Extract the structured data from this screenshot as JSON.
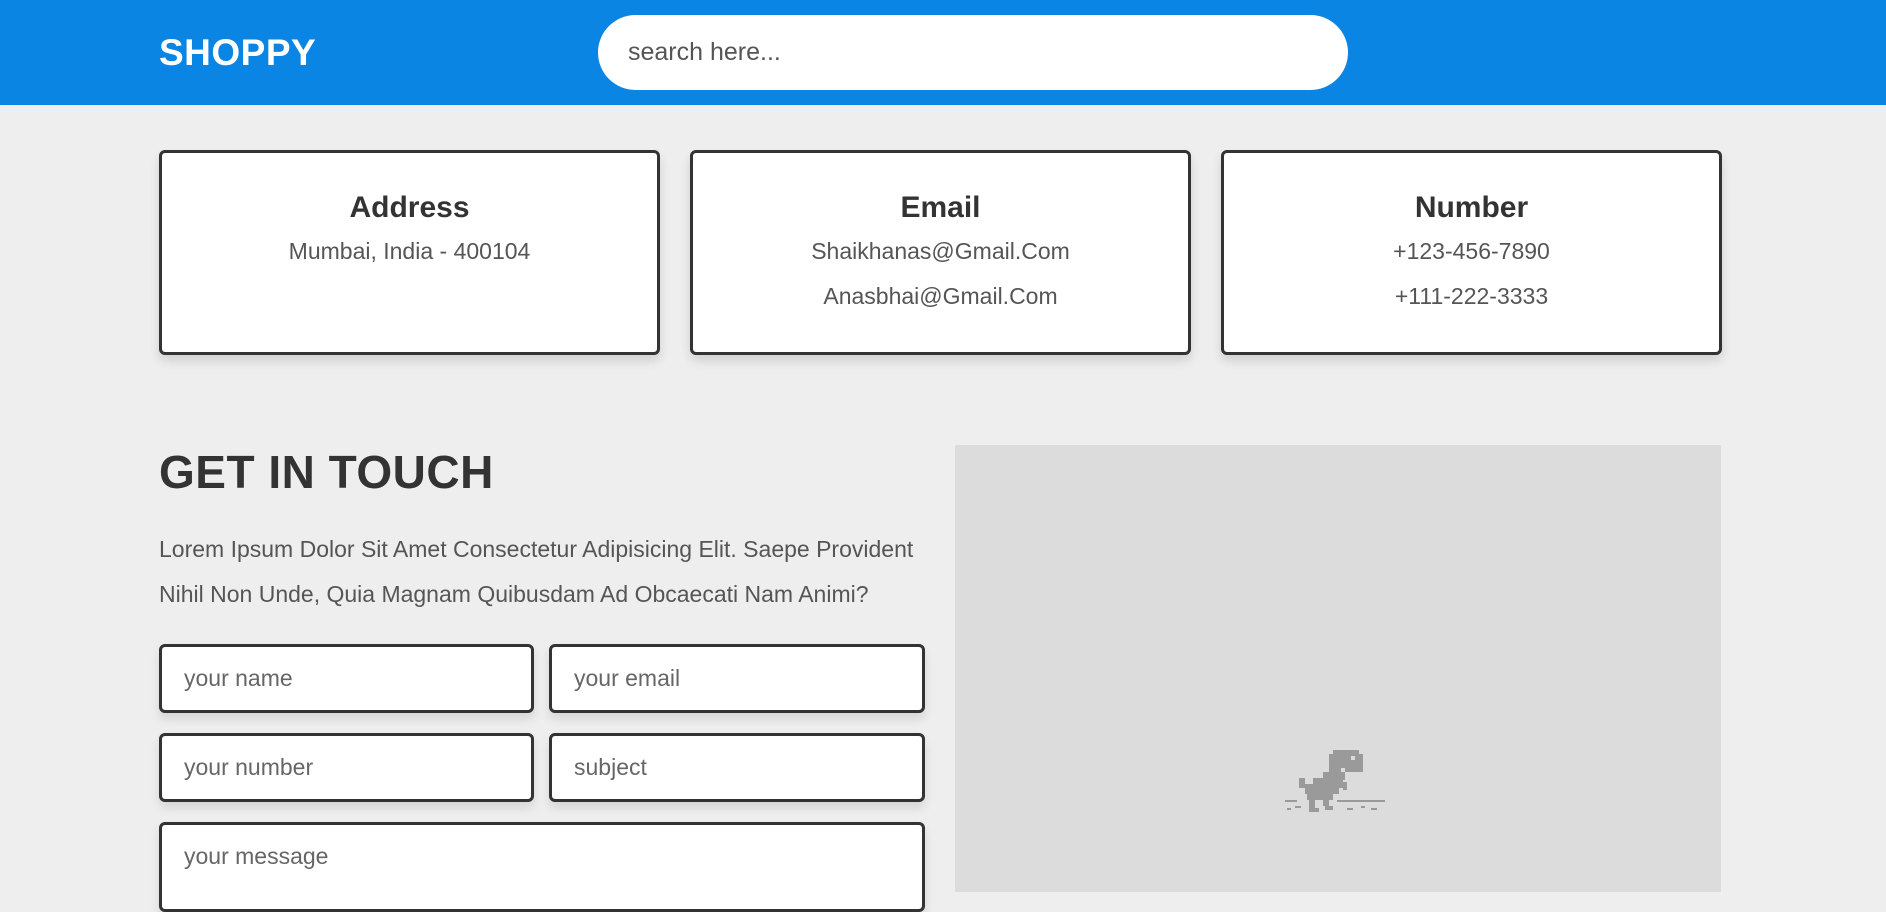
{
  "header": {
    "logo": "SHOPPY",
    "search_placeholder": "search here..."
  },
  "contact_cards": [
    {
      "title": "Address",
      "lines": [
        "Mumbai, India - 400104"
      ]
    },
    {
      "title": "Email",
      "lines": [
        "Shaikhanas@Gmail.Com",
        "Anasbhai@Gmail.Com"
      ]
    },
    {
      "title": "Number",
      "lines": [
        "+123-456-7890",
        "+111-222-3333"
      ]
    }
  ],
  "contact_form": {
    "title": "GET IN TOUCH",
    "description": "Lorem Ipsum Dolor Sit Amet Consectetur Adipisicing Elit. Saepe Provident Nihil Non Unde, Quia Magnam Quibusdam Ad Obcaecati Nam Animi?",
    "name_placeholder": "your name",
    "email_placeholder": "your email",
    "number_placeholder": "your number",
    "subject_placeholder": "subject",
    "message_placeholder": "your message"
  },
  "map": {
    "status_icon": "offline-dino-icon"
  },
  "colors": {
    "header_bg": "#0a85e4",
    "page_bg": "#eeeeee",
    "card_bg": "#ffffff",
    "text_dark": "#333333"
  }
}
